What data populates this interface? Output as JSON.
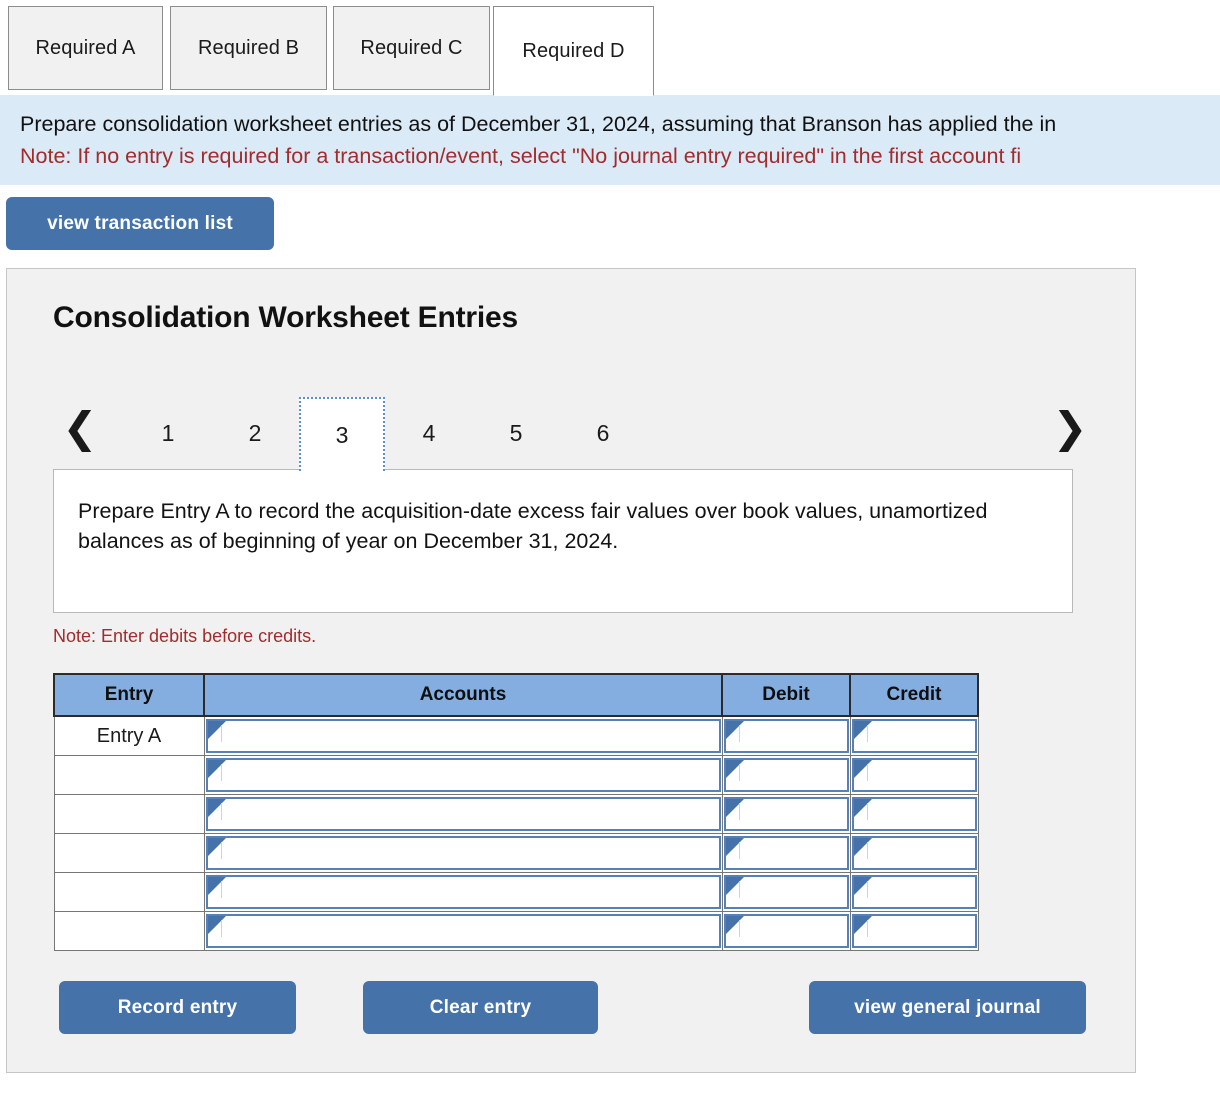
{
  "tabs": [
    {
      "label": "Required A",
      "active": false
    },
    {
      "label": "Required B",
      "active": false
    },
    {
      "label": "Required C",
      "active": false
    },
    {
      "label": "Required D",
      "active": true
    }
  ],
  "banner": {
    "instruction": "Prepare consolidation worksheet entries as of December 31, 2024, assuming that Branson has applied the in",
    "note": "Note: If no entry is required for a transaction/event, select \"No journal entry required\" in the first account fi"
  },
  "toolbar": {
    "view_transaction_list": "view transaction list"
  },
  "panel": {
    "title": "Consolidation Worksheet Entries",
    "pager": {
      "prev_icon": "chevron-left-icon",
      "next_icon": "chevron-right-icon",
      "pages": [
        "1",
        "2",
        "3",
        "4",
        "5",
        "6"
      ],
      "selected": "3"
    },
    "description": "Prepare Entry A to record the acquisition-date excess fair values over book values, unamortized balances as of beginning of year on December 31, 2024.",
    "note_debits": "Note: Enter debits before credits.",
    "table": {
      "headers": [
        "Entry",
        "Accounts",
        "Debit",
        "Credit"
      ],
      "rows": [
        {
          "entry": "Entry A",
          "accounts": "",
          "debit": "",
          "credit": ""
        },
        {
          "entry": "",
          "accounts": "",
          "debit": "",
          "credit": ""
        },
        {
          "entry": "",
          "accounts": "",
          "debit": "",
          "credit": ""
        },
        {
          "entry": "",
          "accounts": "",
          "debit": "",
          "credit": ""
        },
        {
          "entry": "",
          "accounts": "",
          "debit": "",
          "credit": ""
        },
        {
          "entry": "",
          "accounts": "",
          "debit": "",
          "credit": ""
        }
      ]
    },
    "buttons": {
      "record_entry": "Record entry",
      "clear_entry": "Clear entry",
      "view_general_journal": "view general journal"
    }
  },
  "colors": {
    "accent_blue": "#4472a9",
    "banner_bg": "#dbeaf7",
    "table_header_blue": "#85aee0",
    "note_red": "#a02c2c",
    "panel_bg": "#f1f1f1"
  }
}
